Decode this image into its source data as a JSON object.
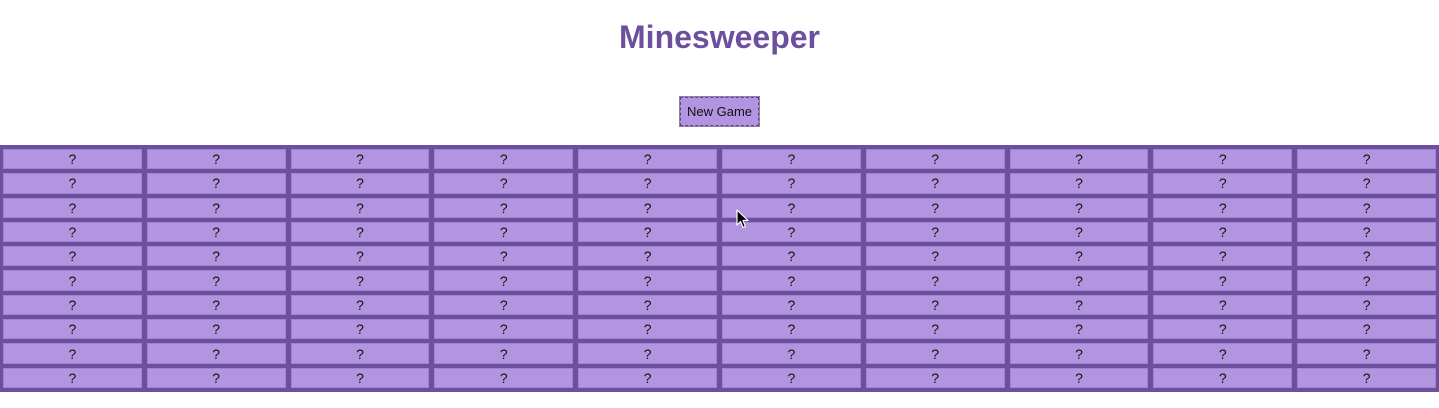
{
  "title": "Minesweeper",
  "new_game_label": "New Game",
  "colors": {
    "board": "#6c4f9d",
    "cell": "#b394e0",
    "title": "#6c4f9d"
  },
  "board": {
    "rows": [
      [
        "?",
        "?",
        "?",
        "?",
        "?",
        "?",
        "?",
        "?",
        "?",
        "?"
      ],
      [
        "?",
        "?",
        "?",
        "?",
        "?",
        "?",
        "?",
        "?",
        "?",
        "?"
      ],
      [
        "?",
        "?",
        "?",
        "?",
        "?",
        "?",
        "?",
        "?",
        "?",
        "?"
      ],
      [
        "?",
        "?",
        "?",
        "?",
        "?",
        "?",
        "?",
        "?",
        "?",
        "?"
      ],
      [
        "?",
        "?",
        "?",
        "?",
        "?",
        "?",
        "?",
        "?",
        "?",
        "?"
      ],
      [
        "?",
        "?",
        "?",
        "?",
        "?",
        "?",
        "?",
        "?",
        "?",
        "?"
      ],
      [
        "?",
        "?",
        "?",
        "?",
        "?",
        "?",
        "?",
        "?",
        "?",
        "?"
      ],
      [
        "?",
        "?",
        "?",
        "?",
        "?",
        "?",
        "?",
        "?",
        "?",
        "?"
      ],
      [
        "?",
        "?",
        "?",
        "?",
        "?",
        "?",
        "?",
        "?",
        "?",
        "?"
      ],
      [
        "?",
        "?",
        "?",
        "?",
        "?",
        "?",
        "?",
        "?",
        "?",
        "?"
      ]
    ]
  },
  "cursor_icon": "mouse-pointer-icon"
}
